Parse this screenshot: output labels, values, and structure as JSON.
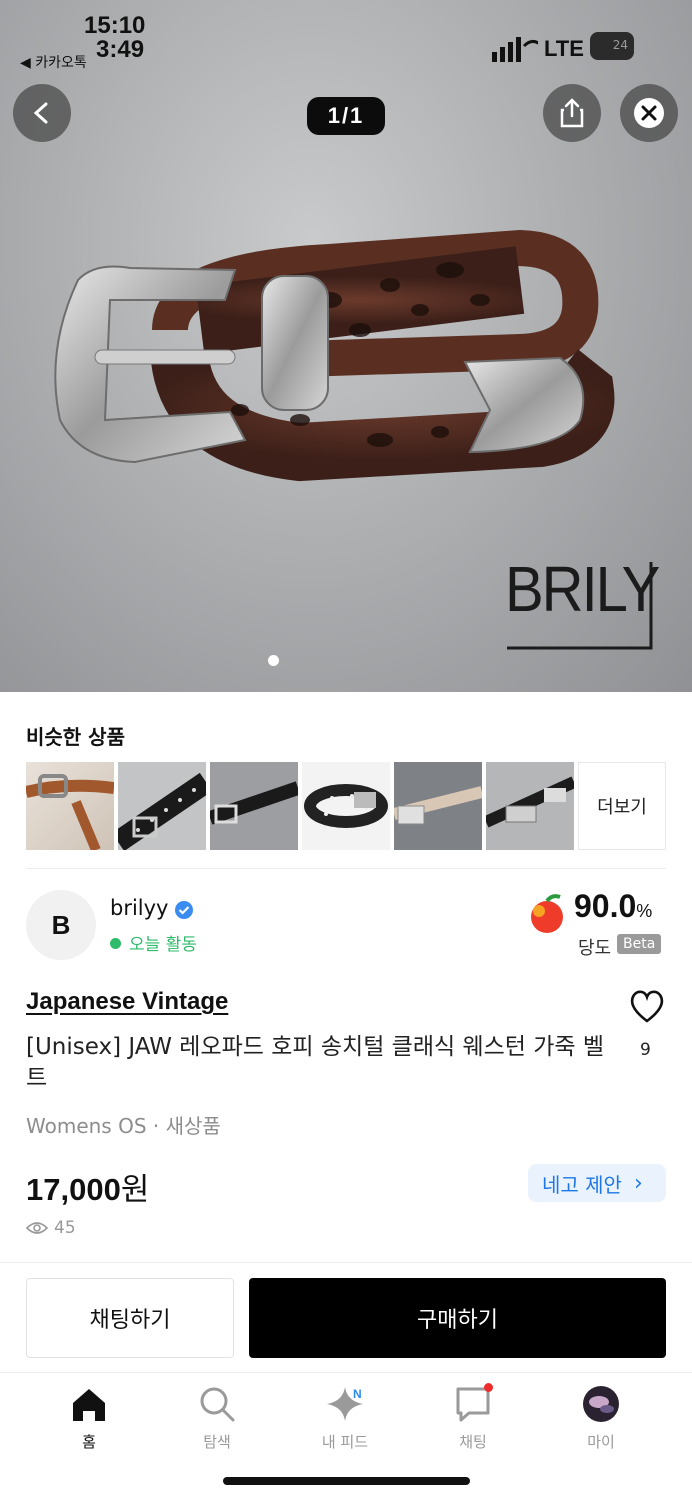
{
  "status_bar": {
    "time_top": "15:10",
    "time_bottom": "3:49",
    "back_app": "◀ 카카오톡",
    "network": "LTE",
    "battery": "24"
  },
  "viewer": {
    "counter": "1/1",
    "watermark": "BRILY"
  },
  "similar": {
    "title": "비슷한 상품",
    "more_label": "더보기",
    "thumbs": [
      {
        "name": "thumb-tan-belt"
      },
      {
        "name": "thumb-studded-black-belt"
      },
      {
        "name": "thumb-studded-belt-2"
      },
      {
        "name": "thumb-star-belt"
      },
      {
        "name": "thumb-leopard-belt"
      },
      {
        "name": "thumb-black-belt"
      }
    ]
  },
  "seller": {
    "name": "brilyy",
    "initial": "B",
    "status": "오늘 활동",
    "score": "90.0",
    "score_unit": "%",
    "score_label": "당도",
    "beta": "Beta"
  },
  "product": {
    "brand": "Japanese Vintage",
    "name": "[Unisex] JAW 레오파드 호피 송치털 클래식 웨스턴 가죽 벨트",
    "meta": "Womens OS · 새상품",
    "price": "17,000",
    "price_unit": "원",
    "negotiate": "네고 제안",
    "views": "45",
    "likes": "9"
  },
  "actions": {
    "chat": "채팅하기",
    "buy": "구매하기"
  },
  "tabs": [
    {
      "label": "홈",
      "icon": "home-icon",
      "active": true
    },
    {
      "label": "탐색",
      "icon": "search-icon",
      "active": false
    },
    {
      "label": "내 피드",
      "icon": "sparkle-icon",
      "badge": "N"
    },
    {
      "label": "채팅",
      "icon": "chat-icon",
      "badge": "dot"
    },
    {
      "label": "마이",
      "icon": "profile-avatar"
    }
  ]
}
